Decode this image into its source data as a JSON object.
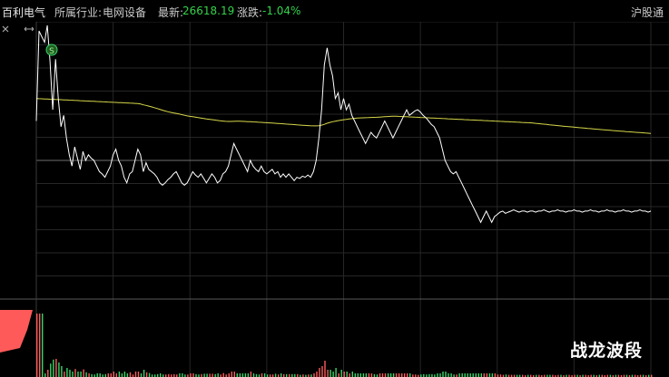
{
  "header": {
    "stock_name": "百利电气",
    "industry_label": "所属行业:",
    "industry_value": "电网设备",
    "latest_label": "最新:",
    "latest_value": "26618.19",
    "change_label": "涨跌:",
    "change_value": "-1.04%",
    "exchange": "沪股通"
  },
  "controls": {
    "close_icon": "close-icon",
    "expand_icon": "expand-arrows-icon"
  },
  "marker": {
    "label": "S"
  },
  "brand": "战龙波段",
  "colors": {
    "price_line": "#ffffff",
    "avg_line": "#d8d84a",
    "up_volume": "#ff5a5a",
    "down_volume": "#3ad36a",
    "grid": "#2f2f2f",
    "prev_close_line": "#707070"
  },
  "chart_data": {
    "type": "line",
    "x_range": [
      0,
      240
    ],
    "ylim": [
      -1.2,
      1.2
    ],
    "prev_close": 0,
    "grid": true,
    "series": [
      {
        "values": [
          0.35,
          1.15,
          1.1,
          1.05,
          1.2,
          0.88,
          0.45,
          0.9,
          0.55,
          0.3,
          0.4,
          0.2,
          0.05,
          -0.05,
          0.12,
          0.02,
          -0.08,
          0.08,
          0.0,
          0.05,
          0.02,
          0.0,
          -0.05,
          -0.1,
          -0.12,
          -0.15,
          -0.1,
          -0.05,
          0.05,
          0.1,
          0.0,
          -0.05,
          -0.15,
          -0.2,
          -0.12,
          -0.1,
          0.0,
          0.1,
          0.05,
          -0.1,
          -0.02,
          -0.08,
          -0.1,
          -0.12,
          -0.15,
          -0.2,
          -0.22,
          -0.2,
          -0.17,
          -0.15,
          -0.12,
          -0.1,
          -0.15,
          -0.2,
          -0.22,
          -0.2,
          -0.15,
          -0.1,
          -0.13,
          -0.15,
          -0.12,
          -0.16,
          -0.2,
          -0.16,
          -0.12,
          -0.15,
          -0.2,
          -0.18,
          -0.12,
          -0.1,
          -0.05,
          0.05,
          0.15,
          0.1,
          0.05,
          0.0,
          -0.05,
          -0.1,
          0.0,
          -0.05,
          -0.08,
          -0.1,
          -0.05,
          -0.1,
          -0.12,
          -0.1,
          -0.08,
          -0.12,
          -0.1,
          -0.15,
          -0.12,
          -0.15,
          -0.12,
          -0.15,
          -0.18,
          -0.15,
          -0.16,
          -0.14,
          -0.15,
          -0.13,
          -0.15,
          -0.1,
          0.0,
          0.2,
          0.45,
          0.85,
          1.0,
          0.85,
          0.75,
          0.55,
          0.6,
          0.45,
          0.55,
          0.45,
          0.5,
          0.4,
          0.35,
          0.3,
          0.25,
          0.2,
          0.15,
          0.2,
          0.25,
          0.22,
          0.2,
          0.25,
          0.3,
          0.35,
          0.3,
          0.25,
          0.2,
          0.25,
          0.3,
          0.35,
          0.4,
          0.45,
          0.4,
          0.42,
          0.44,
          0.45,
          0.43,
          0.4,
          0.38,
          0.35,
          0.32,
          0.3,
          0.25,
          0.2,
          0.1,
          0.0,
          -0.05,
          -0.1,
          -0.12,
          -0.1,
          -0.15,
          -0.2,
          -0.25,
          -0.3,
          -0.35,
          -0.4,
          -0.45,
          -0.5,
          -0.55,
          -0.5,
          -0.45,
          -0.5,
          -0.55,
          -0.5,
          -0.48,
          -0.46,
          -0.45,
          -0.47,
          -0.46,
          -0.45,
          -0.44,
          -0.45,
          -0.46,
          -0.45,
          -0.45,
          -0.46,
          -0.45,
          -0.45,
          -0.46,
          -0.45,
          -0.45,
          -0.44,
          -0.45,
          -0.46,
          -0.45,
          -0.45,
          -0.44,
          -0.45,
          -0.45,
          -0.46,
          -0.45,
          -0.45,
          -0.44,
          -0.45,
          -0.45,
          -0.46,
          -0.45,
          -0.45,
          -0.44,
          -0.45,
          -0.45,
          -0.46,
          -0.45,
          -0.45,
          -0.44,
          -0.45,
          -0.45,
          -0.46,
          -0.45,
          -0.45,
          -0.44,
          -0.45,
          -0.45,
          -0.46,
          -0.45,
          -0.45,
          -0.44,
          -0.45,
          -0.45,
          -0.46,
          -0.45
        ]
      }
    ]
  }
}
